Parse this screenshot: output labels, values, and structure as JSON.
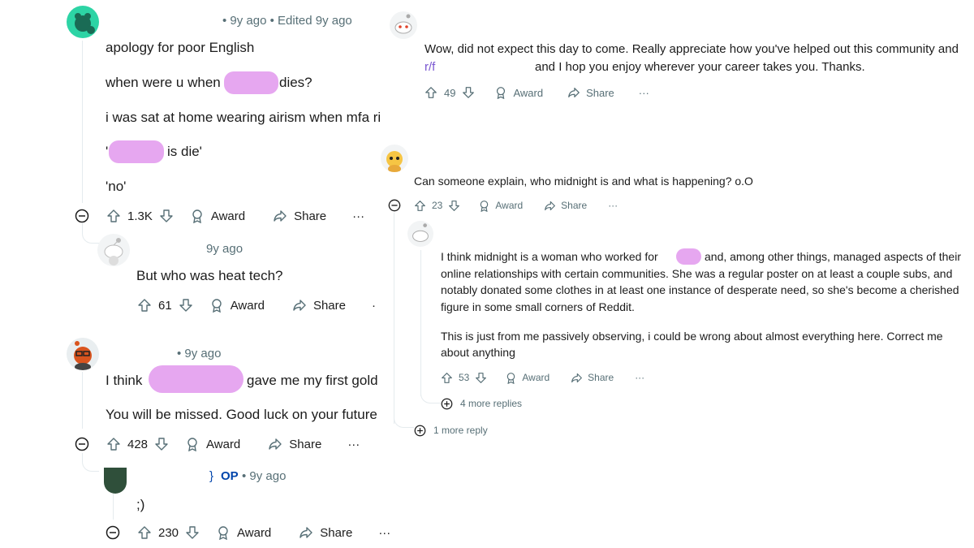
{
  "left": {
    "c1": {
      "meta": "• 9y ago • Edited 9y ago",
      "lines": [
        "apology for poor English",
        "when were u when r",
        "dies?",
        "i was sat at home wearing airism when mfa ring",
        "'",
        "is die'",
        "'no'"
      ],
      "votes": "1.3K",
      "award": "Award",
      "share": "Share",
      "more": "···"
    },
    "c2": {
      "meta": "9y ago",
      "text": "But who was heat tech?",
      "votes": "61",
      "award": "Award",
      "share": "Share",
      "more": "·"
    },
    "c3": {
      "meta": "• 9y ago",
      "line1a": "I think",
      "line1b": "gave me my first gold",
      "line2": "You will be missed. Good luck on your future e",
      "votes": "428",
      "award": "Award",
      "share": "Share",
      "more": "···"
    },
    "c4": {
      "op": "OP",
      "meta": "• 9y ago",
      "text": ";)",
      "votes": "230",
      "award": "Award",
      "share": "Share",
      "more": "···",
      "edge_char": "}"
    }
  },
  "right": {
    "r1": {
      "line1": "Wow, did not expect this day to come. Really appreciate how you've helped out this community and",
      "link": "r/f",
      "line2": "and I hop you enjoy wherever your career takes you. Thanks.",
      "votes": "49",
      "award": "Award",
      "share": "Share",
      "more": "···"
    },
    "r2": {
      "text": "Can someone explain, who midnight is and what is happening? o.O",
      "votes": "23",
      "award": "Award",
      "share": "Share",
      "more": "···"
    },
    "r3": {
      "p1": [
        "I think midnight is a woman who worked for",
        "and, among other things, managed aspects of their",
        "online relationships with certain communities. She was a regular poster on at least a couple subs, and",
        "notably donated some clothes in at least one instance of desperate need, so she's become a cherished",
        "figure in some small corners of Reddit."
      ],
      "p2": [
        "This is just from me passively observing, i could be wrong about almost everything here. Correct me",
        "about anything"
      ],
      "votes": "53",
      "award": "Award",
      "share": "Share",
      "more": "···",
      "more_replies": "4 more replies"
    },
    "one_more_reply": "1 more reply"
  },
  "icons": [
    "upvote-icon",
    "downvote-icon",
    "award-icon",
    "share-icon",
    "collapse-icon",
    "expand-icon",
    "snoo-avatar-icon"
  ],
  "colors": {
    "redaction": "#e6a7f0",
    "meta": "#576f76",
    "op": "#0045ac",
    "link": "#7a57d1",
    "thread": "#e5ebee"
  }
}
